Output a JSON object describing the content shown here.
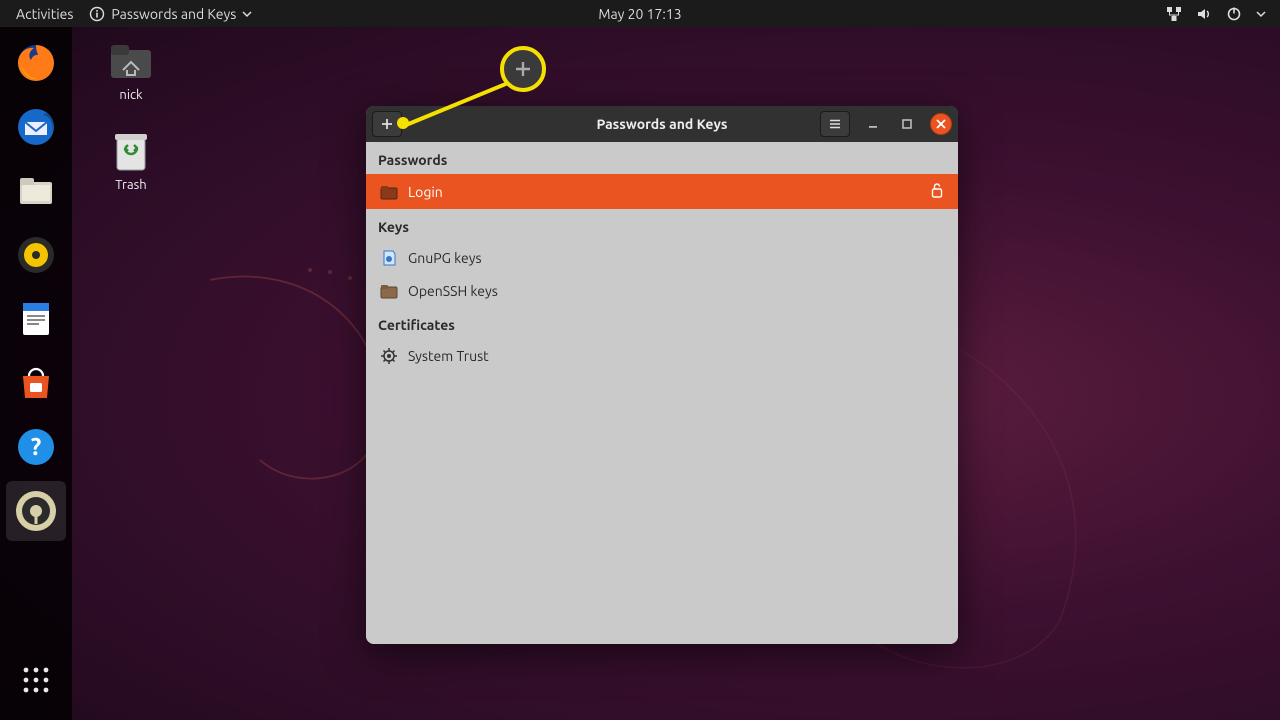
{
  "top_panel": {
    "activities": "Activities",
    "app_menu": "Passwords and Keys",
    "clock": "May 20  17:13"
  },
  "desktop": {
    "home_label": "nick",
    "trash_label": "Trash"
  },
  "window": {
    "title": "Passwords and Keys",
    "sections": {
      "passwords_header": "Passwords",
      "login": "Login",
      "keys_header": "Keys",
      "gnupg": "GnuPG keys",
      "openssh": "OpenSSH keys",
      "certs_header": "Certificates",
      "system_trust": "System Trust"
    }
  }
}
